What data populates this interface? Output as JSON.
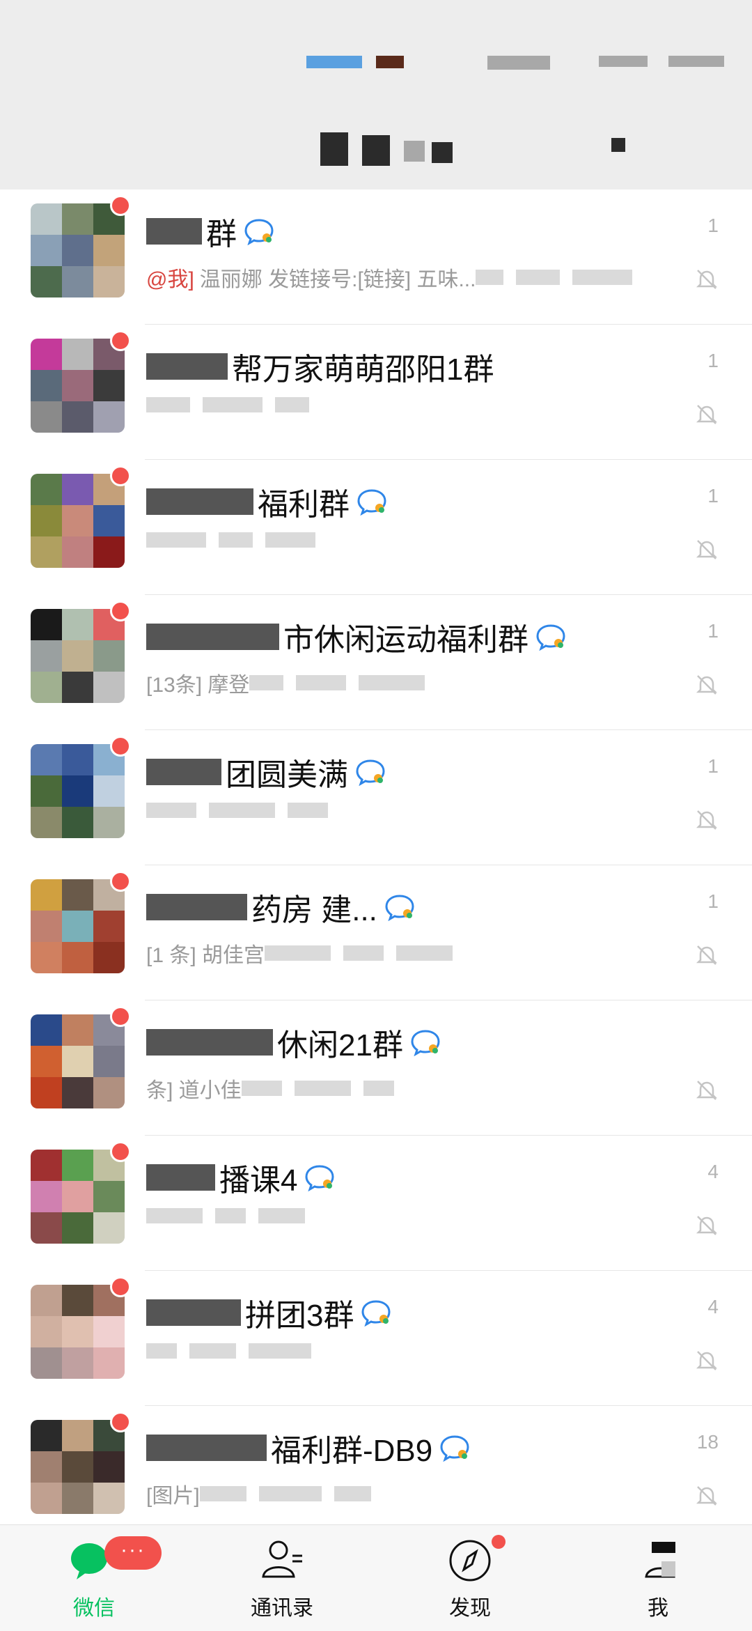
{
  "header": {
    "title": ""
  },
  "chats": [
    {
      "name": "群",
      "preview_mention": "@我]",
      "preview": "温丽娜 发链接号:[链接] 五味...",
      "time": "1",
      "group_tag": true,
      "avatar_colors": [
        "#b9c6c8",
        "#7a8a6a",
        "#3f5a3a",
        "#8aa0b6",
        "#5f6f8c",
        "#c2a37a",
        "#4d6b4d",
        "#7c8b9c",
        "#c9b39a"
      ]
    },
    {
      "name": "帮万家萌萌邵阳1群",
      "preview_mention": "",
      "preview": "",
      "time": "1",
      "group_tag": false,
      "avatar_colors": [
        "#c43a9a",
        "#b8b8b8",
        "#7a5a6a",
        "#5a6a7a",
        "#9a6a7a",
        "#3b3b3b",
        "#8a8a8a",
        "#5b5b6b",
        "#a0a0b0"
      ]
    },
    {
      "name": "福利群",
      "preview_mention": "",
      "preview": "",
      "time": "1",
      "group_tag": true,
      "avatar_colors": [
        "#5a7a4a",
        "#7a5ab0",
        "#c4a07a",
        "#8a8a3a",
        "#c98a7a",
        "#3a5a9a",
        "#b0a060",
        "#c08080",
        "#8a1a1a"
      ]
    },
    {
      "name": "市休闲运动福利群",
      "preview_mention": "",
      "preview": "[13条] 摩登",
      "time": "1",
      "group_tag": true,
      "avatar_colors": [
        "#1a1a1a",
        "#b0c0b0",
        "#e06060",
        "#9aa0a0",
        "#c0b090",
        "#8a9a8a",
        "#a0b090",
        "#3a3a3a",
        "#c0c0c0"
      ]
    },
    {
      "name": "团圆美满",
      "preview_mention": "",
      "preview": "",
      "time": "1",
      "group_tag": true,
      "avatar_colors": [
        "#5a7ab0",
        "#3a5a9a",
        "#8ab0d0",
        "#4a6a3a",
        "#1a3a7a",
        "#c0d0e0",
        "#8a8a6a",
        "#3a5a3a",
        "#aab0a0"
      ]
    },
    {
      "name": "药房 建...",
      "preview_mention": "",
      "preview": "[1 条] 胡佳宫",
      "time": "1",
      "group_tag": true,
      "avatar_colors": [
        "#d0a040",
        "#6a5a4a",
        "#c0b0a0",
        "#c08070",
        "#7ab0b8",
        "#a04030",
        "#d08060",
        "#c06040",
        "#8a3020"
      ]
    },
    {
      "name": "休闲21群",
      "preview_mention": "",
      "preview": "条] 道小佳",
      "time": "",
      "group_tag": true,
      "avatar_colors": [
        "#2a4a8a",
        "#c08060",
        "#8a8a9a",
        "#d06030",
        "#e0d0b0",
        "#7a7a8a",
        "#c04020",
        "#4a3a3a",
        "#b09080"
      ]
    },
    {
      "name": "播课4",
      "preview_mention": "",
      "preview": "",
      "time": "4",
      "group_tag": true,
      "avatar_colors": [
        "#a03030",
        "#5aa050",
        "#c0c0a0",
        "#d080b0",
        "#e0a0a0",
        "#6a8a5a",
        "#8a4a4a",
        "#4a6a3a",
        "#d0d0c0"
      ]
    },
    {
      "name": "拼团3群",
      "preview_mention": "",
      "preview": "",
      "time": "4",
      "group_tag": true,
      "avatar_colors": [
        "#c0a090",
        "#5a4a3a",
        "#a07060",
        "#d0b0a0",
        "#e0c0b0",
        "#f0d0d0",
        "#a09090",
        "#c0a0a0",
        "#e0b0b0"
      ]
    },
    {
      "name": "福利群-DB9",
      "preview_mention": "",
      "preview": "[图片]",
      "time": "18",
      "group_tag": true,
      "avatar_colors": [
        "#2a2a2a",
        "#c0a080",
        "#3a4a3a",
        "#a08070",
        "#5a4a3a",
        "#3a2a2a",
        "#c0a090",
        "#8a7a6a",
        "#d0c0b0"
      ]
    }
  ],
  "tabs": [
    {
      "label": "微信",
      "icon": "chat-bubbles-icon",
      "active": true,
      "badge": "···"
    },
    {
      "label": "通讯录",
      "icon": "contacts-icon",
      "active": false,
      "badge": ""
    },
    {
      "label": "发现",
      "icon": "compass-icon",
      "active": false,
      "badge": ""
    },
    {
      "label": "我",
      "icon": "person-icon",
      "active": false,
      "badge": ""
    }
  ],
  "colors": {
    "accent": "#07c160",
    "badge": "#f2514c",
    "header_bg": "#ededed"
  }
}
